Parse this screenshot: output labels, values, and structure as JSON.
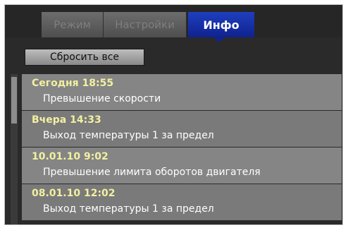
{
  "tabs": [
    {
      "label": "Режим"
    },
    {
      "label": "Настройки"
    },
    {
      "label": "Инфо",
      "active": true
    }
  ],
  "reset_button": {
    "label": "Сбросить все"
  },
  "events": [
    {
      "time": "Сегодня 18:55",
      "text": "Превышение скорости"
    },
    {
      "time": "Вчера 14:33",
      "text": "Выход температуры 1 за предел"
    },
    {
      "time": "10.01.10 9:02",
      "text": "Превышение лимита оборотов двигателя"
    },
    {
      "time": "08.01.10 12:02",
      "text": "Выход температуры 1 за предел"
    }
  ],
  "colors": {
    "active_tab": "#10228d",
    "event_time": "#f2f0a0",
    "panel_background": "#2a2a2a"
  }
}
